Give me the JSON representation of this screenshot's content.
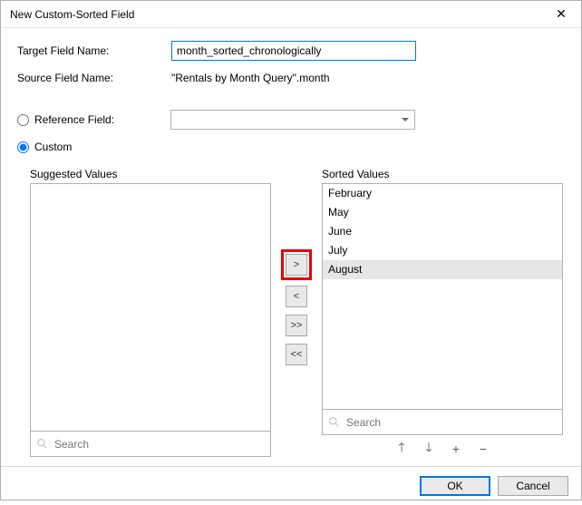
{
  "window": {
    "title": "New Custom-Sorted Field"
  },
  "form": {
    "target_label": "Target Field Name:",
    "target_value": "month_sorted_chronologically",
    "source_label": "Source Field Name:",
    "source_value": "\"Rentals by Month Query\".month",
    "reference_label": "Reference Field:",
    "custom_label": "Custom"
  },
  "lists": {
    "suggested_header": "Suggested Values",
    "sorted_header": "Sorted Values",
    "suggested_items": [],
    "sorted_items": [
      "February",
      "May",
      "June",
      "July",
      "August"
    ],
    "sorted_selected_index": 4,
    "search_placeholder": "Search"
  },
  "move_buttons": {
    "add": ">",
    "remove": "<",
    "add_all": ">>",
    "remove_all": "<<"
  },
  "footer": {
    "ok": "OK",
    "cancel": "Cancel"
  }
}
